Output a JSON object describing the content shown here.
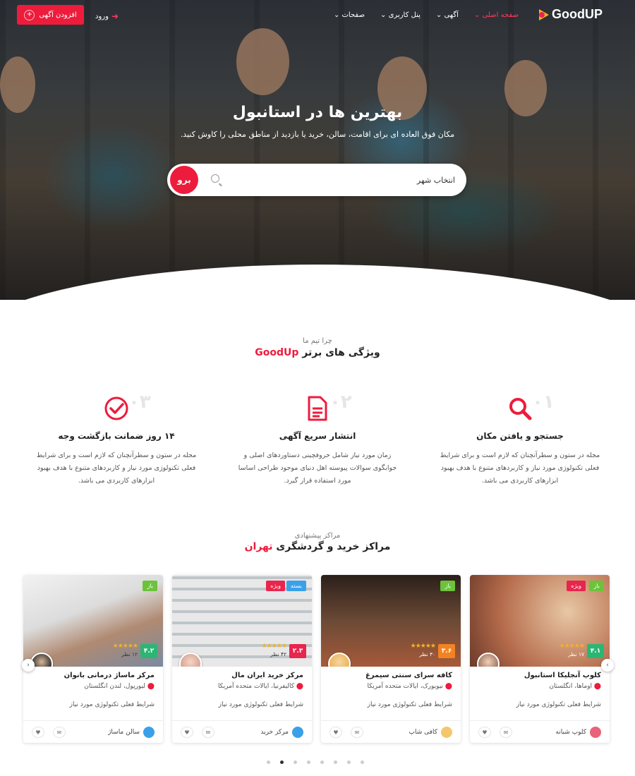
{
  "header": {
    "logo": "GoodUP",
    "menu": [
      "صفحه اصلی",
      "آگهی",
      "پنل کاربری",
      "صفحات"
    ],
    "active_menu": "صفحه اصلی",
    "login": "ورود",
    "add_listing": "افزودن آگهی",
    "chevron": "⌄"
  },
  "hero": {
    "title": "بهترین ها در استانبول",
    "subtitle": "مکان فوق العاده ای برای اقامت، سالن، خرید یا بازدید از مناطق محلی را کاوش کنید.",
    "search_placeholder": "انتخاب شهر",
    "go_label": "برو"
  },
  "features_section": {
    "kicker": "چرا تیم ما",
    "title": "ویژگی های برتر",
    "title_highlight": "GoodUp",
    "items": [
      {
        "num": "۰۱",
        "title": "جستجو و یافتن مکان",
        "desc": "مجله در ستون و سطرآنچنان که لازم است و برای شرایط فعلی تکنولوژی مورد نیاز و کاربردهای متنوع با هدف بهبود ابزارهای کاربردی می باشد.",
        "icon": "search-icon"
      },
      {
        "num": "۰۲",
        "title": "انتشار سریع آگهی",
        "desc": "زمان مورد نیاز شامل حروفچینی دستاوردهای اصلی و جوابگوی سوالات پیوسته اهل دنیای موجود طراحی اساسا مورد استفاده قرار گیرد.",
        "icon": "document-icon"
      },
      {
        "num": "۰۳",
        "title": "۱۴ روز ضمانت بازگشت وجه",
        "desc": "مجله در ستون و سطرآنچنان که لازم است و برای شرایط فعلی تکنولوژی مورد نیاز و کاربردهای متنوع با هدف بهبود ابزارهای کاربردی می باشد.",
        "icon": "check-circle-icon"
      }
    ]
  },
  "listings_section": {
    "kicker": "مراکز پیشنهادی",
    "title": "مراکز خرید و گردشگری",
    "title_highlight": "تهران"
  },
  "listings": [
    {
      "name": "کلوپ آنجلیکا استانبول",
      "location": "اوماها، انگلستان",
      "desc": "شرایط فعلی تکنولوژی مورد نیاز",
      "rating": "۴.۱",
      "rating_color": "#2bb673",
      "votes": "۱۷ نظر",
      "tags": [
        "باز",
        "ویژه"
      ],
      "category": "کلوپ شبانه",
      "category_color": "#e8637a"
    },
    {
      "name": "کافه سرای سنتی سیمرغ",
      "location": "نیویورک، ایالات متحده آمریکا",
      "desc": "شرایط فعلی تکنولوژی مورد نیاز",
      "rating": "۳.۶",
      "rating_color": "#f58220",
      "votes": "۳۰ نظر",
      "tags": [
        "باز"
      ],
      "category": "کافی شاپ",
      "category_color": "#f5c76b"
    },
    {
      "name": "مرکز خرید ایران مال",
      "location": "کالیفرنیا، ایالات متحده آمریکا",
      "desc": "شرایط فعلی تکنولوژی مورد نیاز",
      "rating": "۲.۳",
      "rating_color": "#e8254c",
      "votes": "۴۲ نظر",
      "tags": [
        "بسته",
        "ویژه"
      ],
      "category": "مرکز خرید",
      "category_color": "#3aa0e8"
    },
    {
      "name": "مرکز ماساژ درمانی بانوان",
      "location": "لیورپول، لندن انگلستان",
      "desc": "شرایط فعلی تکنولوژی مورد نیاز",
      "rating": "۴.۲",
      "rating_color": "#2bb673",
      "votes": "۱۲ نظر",
      "tags": [
        "باز"
      ],
      "category": "سالن ماساژ",
      "category_color": "#3aa0e8"
    }
  ],
  "carousel": {
    "dot_count": 8,
    "active_dot": 6,
    "prev": "‹",
    "next": "›"
  }
}
